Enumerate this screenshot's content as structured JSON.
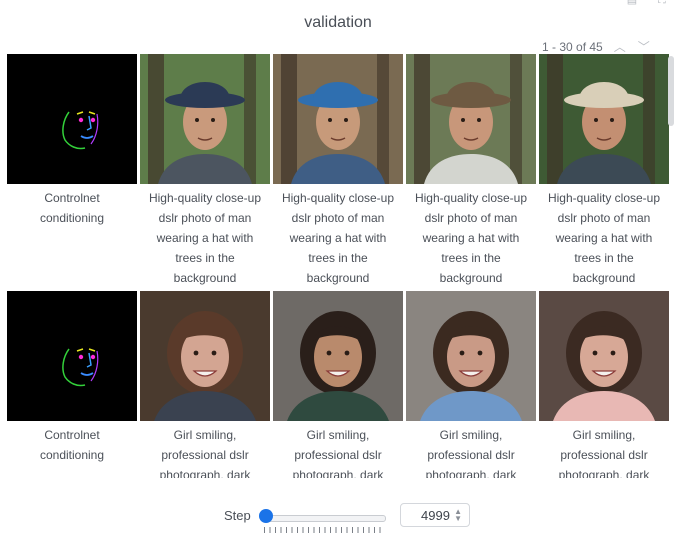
{
  "panel": {
    "title": "validation"
  },
  "pager": {
    "range": "1 - 30 of 45"
  },
  "rows": [
    {
      "cells": [
        {
          "caption": [
            "Controlnet",
            "conditioning"
          ],
          "type": "pose"
        },
        {
          "caption": [
            "High-quality close-up",
            "dslr photo of man",
            "wearing a hat with",
            "trees in the",
            "background"
          ],
          "type": "man",
          "hat": "#2b3a55",
          "bg": "#5e7d4a",
          "shirt": "#4c5560",
          "skin": "#c99a7c"
        },
        {
          "caption": [
            "High-quality close-up",
            "dslr photo of man",
            "wearing a hat with",
            "trees in the",
            "background"
          ],
          "type": "man",
          "hat": "#2f6fb0",
          "bg": "#7a6a52",
          "shirt": "#3f5e85",
          "skin": "#c79a7a"
        },
        {
          "caption": [
            "High-quality close-up",
            "dslr photo of man",
            "wearing a hat with",
            "trees in the",
            "background"
          ],
          "type": "man",
          "hat": "#6e5a42",
          "bg": "#6c7a56",
          "shirt": "#d3d5cf",
          "skin": "#c8977a"
        },
        {
          "caption": [
            "High-quality close-up",
            "dslr photo of man",
            "wearing a hat with",
            "trees in the",
            "background"
          ],
          "type": "man",
          "hat": "#d9cfb8",
          "bg": "#3e5a34",
          "shirt": "#3c4a55",
          "skin": "#c38f72"
        }
      ]
    },
    {
      "cells": [
        {
          "caption": [
            "Controlnet",
            "conditioning"
          ],
          "type": "pose"
        },
        {
          "caption": [
            "Girl smiling,",
            "professional dslr",
            "photograph, dark"
          ],
          "type": "girl",
          "bg": "#4a3a2e",
          "hair": "#5a3a2a",
          "shirt": "#3a4250",
          "skin": "#d3a592"
        },
        {
          "caption": [
            "Girl smiling,",
            "professional dslr",
            "photograph, dark"
          ],
          "type": "girl",
          "bg": "#6e6a66",
          "hair": "#2a1f1a",
          "shirt": "#2f4a3f",
          "skin": "#b98a6c"
        },
        {
          "caption": [
            "Girl smiling,",
            "professional dslr",
            "photograph, dark"
          ],
          "type": "girl",
          "bg": "#8a8580",
          "hair": "#3b2a20",
          "shirt": "#6f98c8",
          "skin": "#c99a86"
        },
        {
          "caption": [
            "Girl smiling,",
            "professional dslr",
            "photograph, dark"
          ],
          "type": "girl",
          "bg": "#5a4a44",
          "hair": "#3b2a22",
          "shirt": "#e8b8b4",
          "skin": "#d7a896"
        }
      ]
    }
  ],
  "step": {
    "label": "Step",
    "value": "4999",
    "position": 0
  }
}
